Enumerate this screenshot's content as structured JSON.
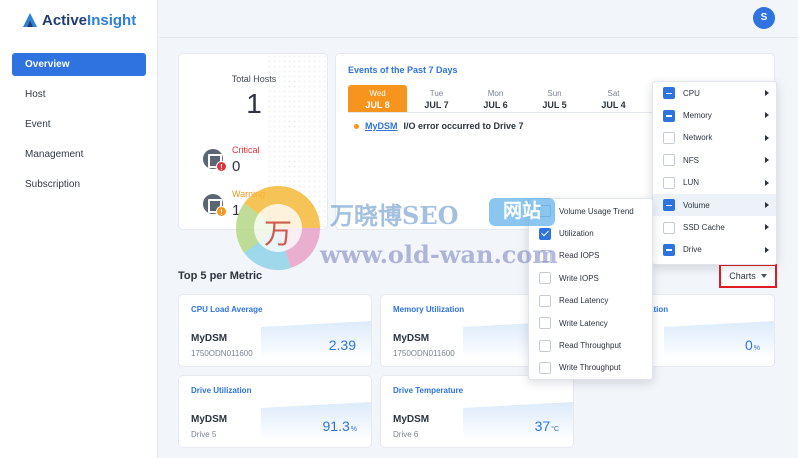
{
  "app": {
    "name_prefix": "Active",
    "name_suffix": "Insight",
    "avatar_initial": "S",
    "accent_color": "#2f73e0"
  },
  "sidebar": {
    "items": [
      {
        "label": "Overview",
        "active": true
      },
      {
        "label": "Host"
      },
      {
        "label": "Event"
      },
      {
        "label": "Management"
      },
      {
        "label": "Subscription"
      }
    ]
  },
  "hosts": {
    "total_label": "Total Hosts",
    "total_value": "1",
    "critical_label": "Critical",
    "critical_value": "0",
    "warning_label": "Warning",
    "warning_value": "1"
  },
  "events": {
    "title": "Events of the Past 7 Days",
    "days": [
      {
        "dow": "Wed",
        "date": "JUL 8",
        "active": true
      },
      {
        "dow": "Tue",
        "date": "JUL 7"
      },
      {
        "dow": "Mon",
        "date": "JUL 6"
      },
      {
        "dow": "Sun",
        "date": "JUL 5"
      },
      {
        "dow": "Sat",
        "date": "JUL 4"
      }
    ],
    "items": [
      {
        "host": "MyDSM",
        "message": "I/O error occurred to Drive 7"
      }
    ]
  },
  "top5": {
    "title": "Top 5 per Metric",
    "charts_button": "Charts"
  },
  "metrics": [
    {
      "title": "CPU Load Average",
      "host": "MyDSM",
      "sub": "1750ODN011600",
      "value": "2.39",
      "unit": ""
    },
    {
      "title": "Memory Utilization",
      "host": "MyDSM",
      "sub": "1750ODN011600",
      "value": "",
      "unit": ""
    },
    {
      "title": "ation",
      "host": "",
      "sub": "",
      "value": "0",
      "unit": "%"
    },
    {
      "title": "Drive Utilization",
      "host": "MyDSM",
      "sub": "Drive 5",
      "value": "91.3",
      "unit": "%"
    },
    {
      "title": "Drive Temperature",
      "host": "MyDSM",
      "sub": "Drive 6",
      "value": "37",
      "unit": "°C"
    }
  ],
  "charts_menu": {
    "items": [
      {
        "label": "CPU",
        "state": "partial",
        "submenu": true
      },
      {
        "label": "Memory",
        "state": "partial",
        "submenu": true
      },
      {
        "label": "Network",
        "state": "none",
        "submenu": true
      },
      {
        "label": "NFS",
        "state": "none",
        "submenu": true
      },
      {
        "label": "LUN",
        "state": "none",
        "submenu": true
      },
      {
        "label": "Volume",
        "state": "partial",
        "submenu": true,
        "hover": true
      },
      {
        "label": "SSD Cache",
        "state": "none",
        "submenu": true
      },
      {
        "label": "Drive",
        "state": "partial",
        "submenu": true
      }
    ]
  },
  "volume_submenu": {
    "items": [
      {
        "label": "Volume Usage Trend",
        "state": "none"
      },
      {
        "label": "Utilization",
        "state": "checked"
      },
      {
        "label": "Read IOPS",
        "state": "none"
      },
      {
        "label": "Write IOPS",
        "state": "none"
      },
      {
        "label": "Read Latency",
        "state": "none"
      },
      {
        "label": "Write Latency",
        "state": "none"
      },
      {
        "label": "Read Throughput",
        "state": "none"
      },
      {
        "label": "Write Throughput",
        "state": "none"
      }
    ]
  },
  "watermark": {
    "glyph": "万",
    "title": "万晓博SEO",
    "badge": "网站",
    "url": "www.old-wan.com"
  }
}
